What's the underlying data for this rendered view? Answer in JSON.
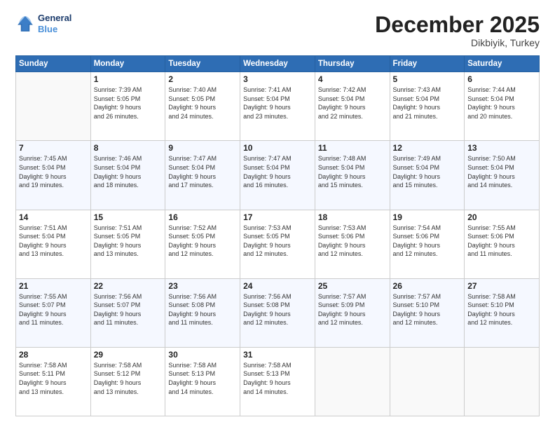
{
  "header": {
    "logo_line1": "General",
    "logo_line2": "Blue",
    "month_title": "December 2025",
    "subtitle": "Dikbiyik, Turkey"
  },
  "days_of_week": [
    "Sunday",
    "Monday",
    "Tuesday",
    "Wednesday",
    "Thursday",
    "Friday",
    "Saturday"
  ],
  "weeks": [
    [
      {
        "num": "",
        "info": ""
      },
      {
        "num": "1",
        "info": "Sunrise: 7:39 AM\nSunset: 5:05 PM\nDaylight: 9 hours\nand 26 minutes."
      },
      {
        "num": "2",
        "info": "Sunrise: 7:40 AM\nSunset: 5:05 PM\nDaylight: 9 hours\nand 24 minutes."
      },
      {
        "num": "3",
        "info": "Sunrise: 7:41 AM\nSunset: 5:04 PM\nDaylight: 9 hours\nand 23 minutes."
      },
      {
        "num": "4",
        "info": "Sunrise: 7:42 AM\nSunset: 5:04 PM\nDaylight: 9 hours\nand 22 minutes."
      },
      {
        "num": "5",
        "info": "Sunrise: 7:43 AM\nSunset: 5:04 PM\nDaylight: 9 hours\nand 21 minutes."
      },
      {
        "num": "6",
        "info": "Sunrise: 7:44 AM\nSunset: 5:04 PM\nDaylight: 9 hours\nand 20 minutes."
      }
    ],
    [
      {
        "num": "7",
        "info": "Sunrise: 7:45 AM\nSunset: 5:04 PM\nDaylight: 9 hours\nand 19 minutes."
      },
      {
        "num": "8",
        "info": "Sunrise: 7:46 AM\nSunset: 5:04 PM\nDaylight: 9 hours\nand 18 minutes."
      },
      {
        "num": "9",
        "info": "Sunrise: 7:47 AM\nSunset: 5:04 PM\nDaylight: 9 hours\nand 17 minutes."
      },
      {
        "num": "10",
        "info": "Sunrise: 7:47 AM\nSunset: 5:04 PM\nDaylight: 9 hours\nand 16 minutes."
      },
      {
        "num": "11",
        "info": "Sunrise: 7:48 AM\nSunset: 5:04 PM\nDaylight: 9 hours\nand 15 minutes."
      },
      {
        "num": "12",
        "info": "Sunrise: 7:49 AM\nSunset: 5:04 PM\nDaylight: 9 hours\nand 15 minutes."
      },
      {
        "num": "13",
        "info": "Sunrise: 7:50 AM\nSunset: 5:04 PM\nDaylight: 9 hours\nand 14 minutes."
      }
    ],
    [
      {
        "num": "14",
        "info": "Sunrise: 7:51 AM\nSunset: 5:04 PM\nDaylight: 9 hours\nand 13 minutes."
      },
      {
        "num": "15",
        "info": "Sunrise: 7:51 AM\nSunset: 5:05 PM\nDaylight: 9 hours\nand 13 minutes."
      },
      {
        "num": "16",
        "info": "Sunrise: 7:52 AM\nSunset: 5:05 PM\nDaylight: 9 hours\nand 12 minutes."
      },
      {
        "num": "17",
        "info": "Sunrise: 7:53 AM\nSunset: 5:05 PM\nDaylight: 9 hours\nand 12 minutes."
      },
      {
        "num": "18",
        "info": "Sunrise: 7:53 AM\nSunset: 5:06 PM\nDaylight: 9 hours\nand 12 minutes."
      },
      {
        "num": "19",
        "info": "Sunrise: 7:54 AM\nSunset: 5:06 PM\nDaylight: 9 hours\nand 12 minutes."
      },
      {
        "num": "20",
        "info": "Sunrise: 7:55 AM\nSunset: 5:06 PM\nDaylight: 9 hours\nand 11 minutes."
      }
    ],
    [
      {
        "num": "21",
        "info": "Sunrise: 7:55 AM\nSunset: 5:07 PM\nDaylight: 9 hours\nand 11 minutes."
      },
      {
        "num": "22",
        "info": "Sunrise: 7:56 AM\nSunset: 5:07 PM\nDaylight: 9 hours\nand 11 minutes."
      },
      {
        "num": "23",
        "info": "Sunrise: 7:56 AM\nSunset: 5:08 PM\nDaylight: 9 hours\nand 11 minutes."
      },
      {
        "num": "24",
        "info": "Sunrise: 7:56 AM\nSunset: 5:08 PM\nDaylight: 9 hours\nand 12 minutes."
      },
      {
        "num": "25",
        "info": "Sunrise: 7:57 AM\nSunset: 5:09 PM\nDaylight: 9 hours\nand 12 minutes."
      },
      {
        "num": "26",
        "info": "Sunrise: 7:57 AM\nSunset: 5:10 PM\nDaylight: 9 hours\nand 12 minutes."
      },
      {
        "num": "27",
        "info": "Sunrise: 7:58 AM\nSunset: 5:10 PM\nDaylight: 9 hours\nand 12 minutes."
      }
    ],
    [
      {
        "num": "28",
        "info": "Sunrise: 7:58 AM\nSunset: 5:11 PM\nDaylight: 9 hours\nand 13 minutes."
      },
      {
        "num": "29",
        "info": "Sunrise: 7:58 AM\nSunset: 5:12 PM\nDaylight: 9 hours\nand 13 minutes."
      },
      {
        "num": "30",
        "info": "Sunrise: 7:58 AM\nSunset: 5:13 PM\nDaylight: 9 hours\nand 14 minutes."
      },
      {
        "num": "31",
        "info": "Sunrise: 7:58 AM\nSunset: 5:13 PM\nDaylight: 9 hours\nand 14 minutes."
      },
      {
        "num": "",
        "info": ""
      },
      {
        "num": "",
        "info": ""
      },
      {
        "num": "",
        "info": ""
      }
    ]
  ]
}
